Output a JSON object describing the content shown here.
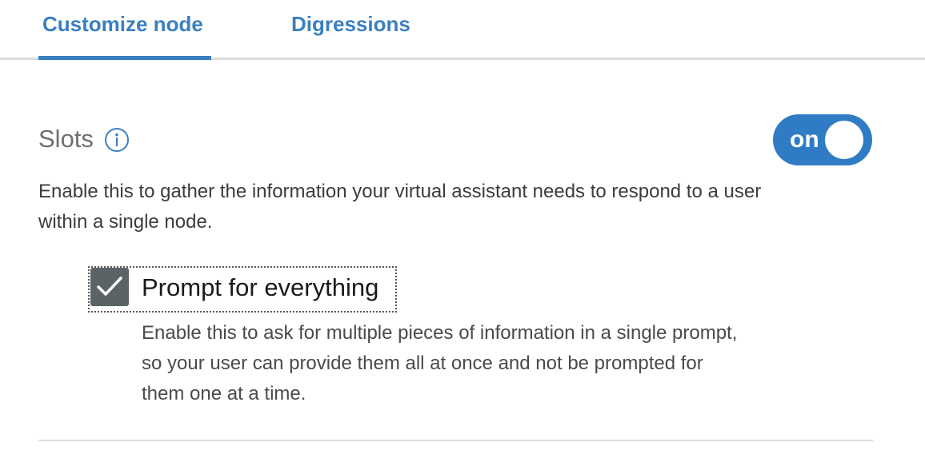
{
  "tabs": {
    "items": [
      {
        "label": "Customize node",
        "active": true
      },
      {
        "label": "Digressions",
        "active": false
      }
    ]
  },
  "slots": {
    "title": "Slots",
    "info_icon": "info-circle-icon",
    "toggle_label": "on",
    "toggle_state": true,
    "description": "Enable this to gather the information your virtual assistant needs to respond to a user within a single node."
  },
  "prompt_for_everything": {
    "label": "Prompt for everything",
    "checked": true,
    "description": "Enable this to ask for multiple pieces of information in a single prompt, so your user can provide them all at once and not be prompted for them one at a time."
  },
  "colors": {
    "accent": "#3a7fc1",
    "toggle_bg": "#2f7cc5",
    "checkbox_bg": "#5b6367"
  }
}
